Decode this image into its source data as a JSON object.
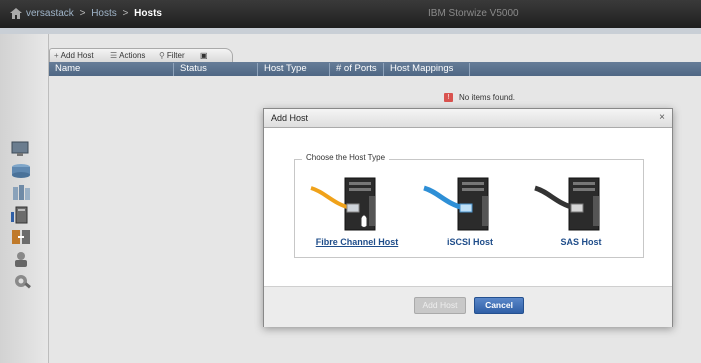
{
  "header": {
    "breadcrumb": [
      "versastack",
      "Hosts"
    ],
    "current": "Hosts",
    "product": "IBM Storwize V5000"
  },
  "toolbar": {
    "add_host": "Add Host",
    "actions": "Actions",
    "filter": "Filter"
  },
  "table": {
    "columns": [
      "Name",
      "Status",
      "Host Type",
      "# of Ports",
      "Host Mappings"
    ],
    "empty_message": "No items found."
  },
  "dialog": {
    "title": "Add Host",
    "close": "×",
    "group_label": "Choose the Host Type",
    "options": [
      "Fibre Channel Host",
      "iSCSI Host",
      "SAS Host"
    ],
    "selected": "Fibre Channel Host",
    "add_button": "Add Host",
    "cancel_button": "Cancel"
  },
  "colors": {
    "accent": "#2f5fa6",
    "header_bar": "#4f6784",
    "fc_cable": "#f0a21a",
    "iscsi_cable": "#2e8fd6",
    "sas_cable": "#333333"
  },
  "sidebar": {
    "icons": [
      "monitoring-icon",
      "pools-icon",
      "volumes-icon",
      "hosts-icon",
      "copy-services-icon",
      "access-icon",
      "settings-icon"
    ]
  }
}
